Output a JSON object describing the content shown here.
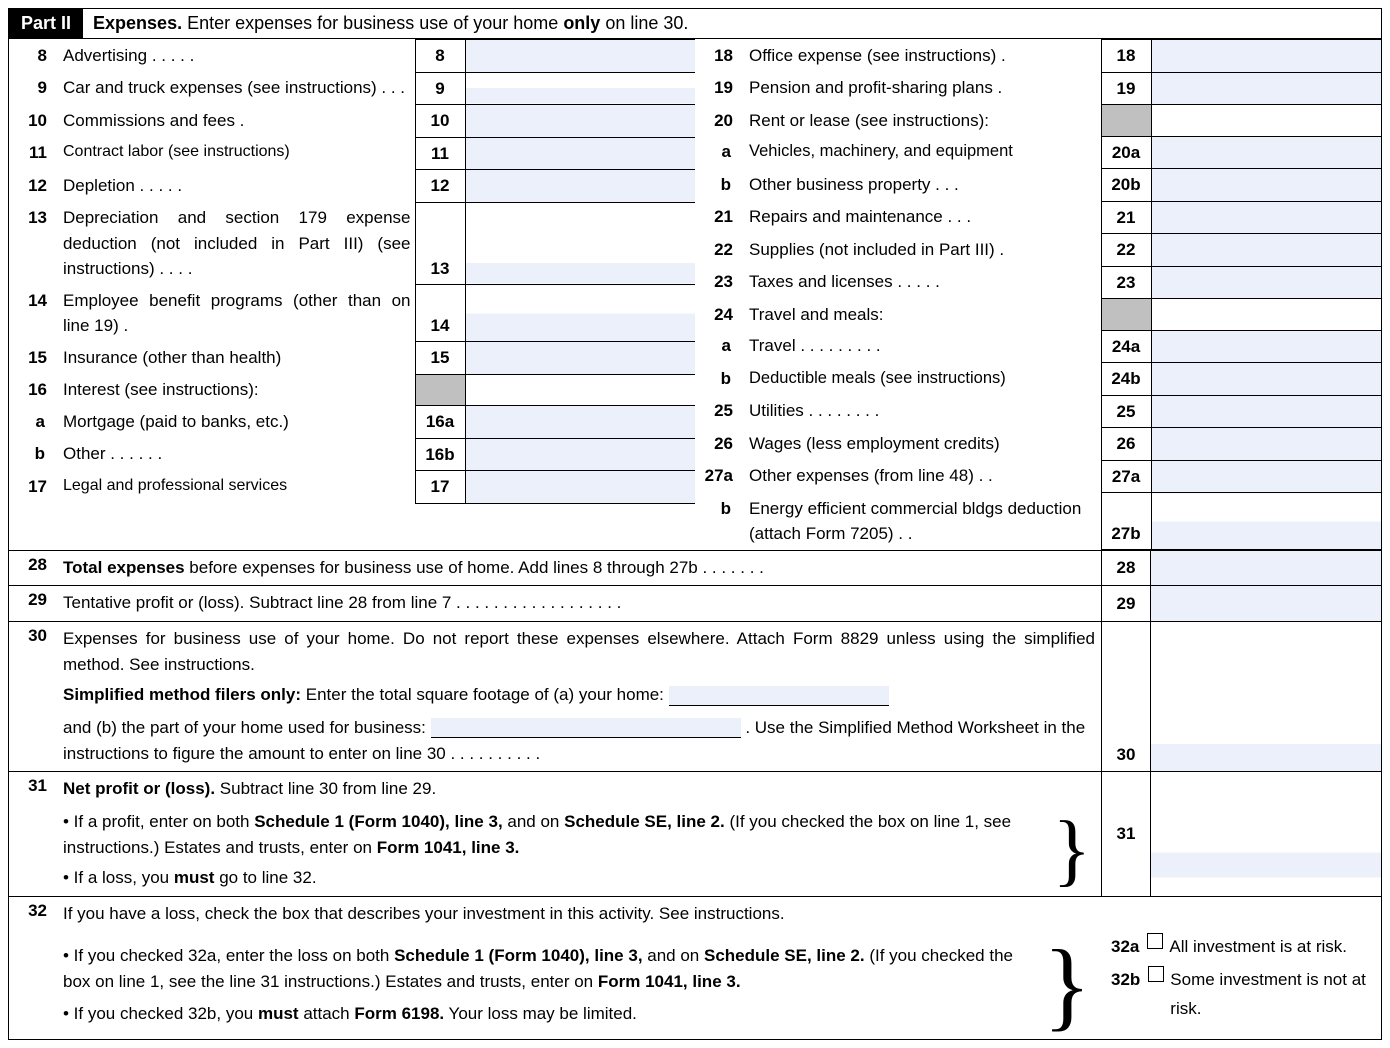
{
  "part": {
    "label": "Part II",
    "title_bold1": "Expenses.",
    "title_text": " Enter expenses for business use of your home ",
    "title_bold2": "only",
    "title_text2": " on line 30."
  },
  "left": {
    "r8": {
      "num": "8",
      "desc": "Advertising .   .   .   .   .",
      "box": "8"
    },
    "r9": {
      "num": "9",
      "desc": "Car and truck expenses (see instructions)   .   .   .",
      "box": "9"
    },
    "r10": {
      "num": "10",
      "desc": "Commissions and fees    .",
      "box": "10"
    },
    "r11": {
      "num": "11",
      "desc": "Contract labor (see instructions)",
      "box": "11"
    },
    "r12": {
      "num": "12",
      "desc": "Depletion   .   .   .   .   .",
      "box": "12"
    },
    "r13": {
      "num": "13",
      "desc": "Depreciation and section 179 expense deduction (not included in Part III) (see instructions)     .   .   .   .",
      "box": "13"
    },
    "r14": {
      "num": "14",
      "desc": "Employee benefit programs (other than on line 19)    .",
      "box": "14"
    },
    "r15": {
      "num": "15",
      "desc": "Insurance (other than health)",
      "box": "15"
    },
    "r16": {
      "num": "16",
      "desc": "Interest (see instructions):",
      "box": ""
    },
    "r16a": {
      "num": "a",
      "desc": "Mortgage (paid to banks, etc.)",
      "box": "16a"
    },
    "r16b": {
      "num": "b",
      "desc": "Other    .   .   .   .   .   .",
      "box": "16b"
    },
    "r17": {
      "num": "17",
      "desc": "Legal and professional services",
      "box": "17"
    }
  },
  "right": {
    "r18": {
      "num": "18",
      "desc": "Office expense (see instructions)  .",
      "box": "18"
    },
    "r19": {
      "num": "19",
      "desc": "Pension and profit-sharing plans  .",
      "box": "19"
    },
    "r20": {
      "num": "20",
      "desc": "Rent or lease (see instructions):",
      "box": ""
    },
    "r20a": {
      "num": "a",
      "desc": "Vehicles, machinery, and equipment",
      "box": "20a"
    },
    "r20b": {
      "num": "b",
      "desc": "Other business property   .   .   .",
      "box": "20b"
    },
    "r21": {
      "num": "21",
      "desc": "Repairs and maintenance  .   .   .",
      "box": "21"
    },
    "r22": {
      "num": "22",
      "desc": "Supplies (not included in Part III)  .",
      "box": "22"
    },
    "r23": {
      "num": "23",
      "desc": "Taxes and licenses .   .   .   .   .",
      "box": "23"
    },
    "r24": {
      "num": "24",
      "desc": "Travel and meals:",
      "box": ""
    },
    "r24a": {
      "num": "a",
      "desc": "Travel .   .   .   .   .   .   .   .   .",
      "box": "24a"
    },
    "r24b": {
      "num": "b",
      "desc": "Deductible meals (see instructions)",
      "box": "24b"
    },
    "r25": {
      "num": "25",
      "desc": "Utilities   .   .   .   .   .   .   .   .",
      "box": "25"
    },
    "r26": {
      "num": "26",
      "desc": "Wages (less employment credits)",
      "box": "26"
    },
    "r27a": {
      "num": "27a",
      "desc": "Other expenses (from line 48) .   .",
      "box": "27a"
    },
    "r27b": {
      "num": "b",
      "desc": "Energy efficient commercial bldgs deduction (attach Form 7205) .   .",
      "box": "27b"
    }
  },
  "line28": {
    "num": "28",
    "desc1": "Total expenses",
    "desc2": " before expenses for business use of home. Add lines 8 through 27b  .   .   .   .   .   .   .",
    "box": "28"
  },
  "line29": {
    "num": "29",
    "desc": "Tentative profit or (loss). Subtract line 28 from line 7 .   .   .   .   .   .   .   .   .   .   .   .   .   .   .   .   .   .",
    "box": "29"
  },
  "line30": {
    "num": "30",
    "p1": "Expenses for business use of your home. Do not report these expenses elsewhere. Attach Form 8829 unless using the simplified method. See instructions.",
    "p2_bold": "Simplified method filers only:",
    "p2": " Enter the total square footage of (a) your home: ",
    "p3a": "and (b) the part of your home used for business: ",
    "p3b": " . Use the Simplified Method Worksheet in the instructions to figure the amount to enter on line 30   .   .   .   .   .   .   .   .   .   .",
    "box": "30"
  },
  "line31": {
    "num": "31",
    "title": "Net profit or (loss).",
    "title2": " Subtract line 30 from line 29.",
    "b1a": "• If a profit, enter on both ",
    "b1b": "Schedule 1 (Form 1040), line 3,",
    "b1c": " and on ",
    "b1d": "Schedule SE, line 2.",
    "b1e": " (If you checked the box on line 1, see instructions.) Estates and trusts, enter on ",
    "b1f": "Form 1041, line 3.",
    "b2a": "• If a loss, you ",
    "b2b": "must",
    "b2c": "  go to line 32.",
    "box": "31"
  },
  "line32": {
    "num": "32",
    "p1": "If you have a loss, check the box that describes your investment in this activity. See instructions.",
    "b1a": "• If you checked 32a, enter the loss on both ",
    "b1b": "Schedule 1 (Form 1040), line 3,",
    "b1c": " and on ",
    "b1d": "Schedule SE, line 2.",
    "b1e": " (If you checked the box on line 1, see the line 31 instructions.) Estates and trusts, enter on ",
    "b1f": "Form 1041, line 3.",
    "b2a": "• If you checked 32b, you ",
    "b2b": "must",
    "b2c": " attach ",
    "b2d": "Form 6198.",
    "b2e": " Your loss may be limited.",
    "opt_a_num": "32a",
    "opt_a": "All investment is at risk.",
    "opt_b_num": "32b",
    "opt_b": "Some investment is not at risk."
  }
}
